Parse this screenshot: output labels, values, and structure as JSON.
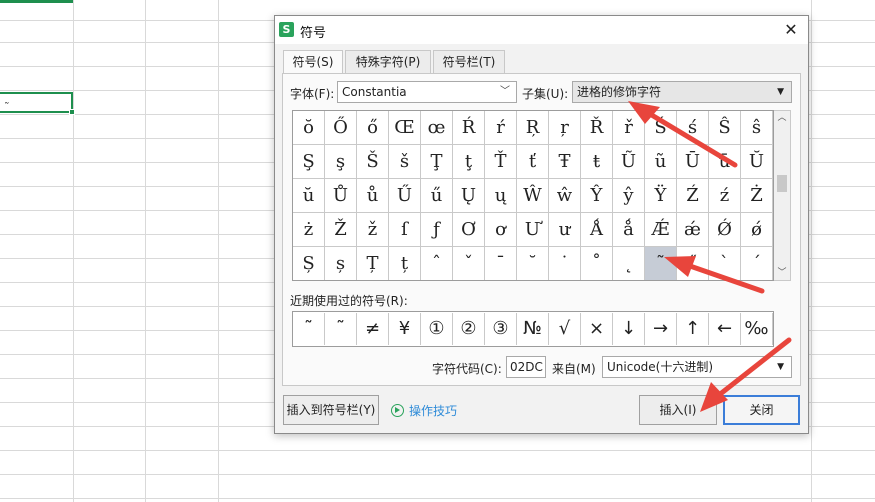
{
  "dialog": {
    "app_icon": "S",
    "title": "符号",
    "close_glyph": "✕",
    "tabs": [
      {
        "label": "符号(S)"
      },
      {
        "label": "特殊字符(P)"
      },
      {
        "label": "符号栏(T)"
      }
    ],
    "font_label": "字体(F):",
    "font_value": "Constantia",
    "subset_label": "子集(U):",
    "subset_value": "进格的修饰字符",
    "grid_rows": [
      [
        "ŏ",
        "Ő",
        "ő",
        "Œ",
        "œ",
        "Ŕ",
        "ŕ",
        "Ŗ",
        "ŗ",
        "Ř",
        "ř",
        "Ś",
        "ś",
        "Ŝ",
        "ŝ"
      ],
      [
        "Ş",
        "ş",
        "Š",
        "š",
        "Ţ",
        "ţ",
        "Ť",
        "ť",
        "Ŧ",
        "ŧ",
        "Ũ",
        "ũ",
        "Ū",
        "ū",
        "Ŭ"
      ],
      [
        "ŭ",
        "Ů",
        "ů",
        "Ű",
        "ű",
        "Ų",
        "ų",
        "Ŵ",
        "ŵ",
        "Ŷ",
        "ŷ",
        "Ÿ",
        "Ź",
        "ź",
        "Ż"
      ],
      [
        "ż",
        "Ž",
        "ž",
        "ſ",
        "ƒ",
        "Ơ",
        "ơ",
        "Ư",
        "ư",
        "Ǻ",
        "ǻ",
        "Ǽ",
        "ǽ",
        "Ǿ",
        "ǿ"
      ],
      [
        "Ș",
        "ș",
        "Ț",
        "ț",
        "ˆ",
        "ˇ",
        "ˉ",
        "˘",
        "˙",
        "˚",
        "˛",
        "˜",
        "˝",
        "ˋ",
        "ˊ"
      ]
    ],
    "selected_glyph": "˜",
    "recent_label": "近期使用过的符号(R):",
    "recent": [
      "˜",
      "˜",
      "≠",
      "¥",
      "①",
      "②",
      "③",
      "№",
      "√",
      "×",
      "↓",
      "→",
      "↑",
      "←",
      "‰"
    ],
    "code_label": "字符代码(C):",
    "code_value": "02DC",
    "from_label": "来自(M)",
    "from_value": "Unicode(十六进制)",
    "insert_to_bar_button": "插入到符号栏(Y)",
    "tips_link": "操作技巧",
    "insert_button": "插入(I)",
    "close_button": "关闭"
  },
  "sheet": {
    "active_cell_text": "˜"
  },
  "colors": {
    "accent_green": "#2aa35c",
    "annotation_red": "#e8453c",
    "link_blue": "#2e8bd8",
    "primary_border": "#3b7dd8"
  }
}
